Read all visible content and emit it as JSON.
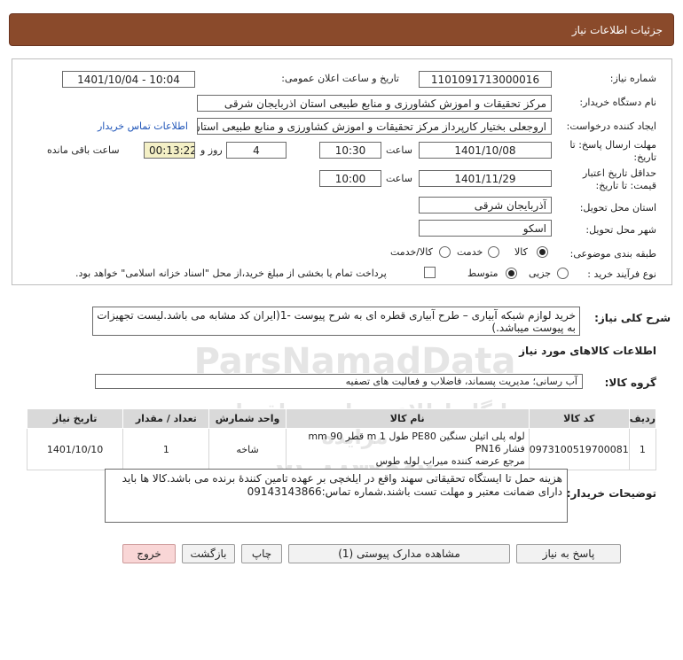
{
  "header": {
    "title": "جزئیات اطلاعات نیاز"
  },
  "form": {
    "need_number_label": "شماره نیاز:",
    "need_number": "1101091713000016",
    "announce_label": "تاریخ و ساعت اعلان عمومی:",
    "announce_value": "1401/10/04 - 10:04",
    "buyer_org_label": "نام دستگاه خریدار:",
    "buyer_org": "مرکز تحقیقات و اموزش کشاورزی و منابع طبیعی استان اذربایجان شرقی",
    "requester_label": "ایجاد کننده درخواست:",
    "requester": "اروجعلی بختیار کارپرداز مرکز تحقیقات و اموزش کشاورزی و منابع طبیعی استان ا",
    "contact_link": "اطلاعات تماس خریدار",
    "deadline_label_1": "مهلت ارسال پاسخ: تا",
    "deadline_label_2": "تاریخ:",
    "deadline_date": "1401/10/08",
    "time_label": "ساعت",
    "deadline_time": "10:30",
    "days_value": "4",
    "days_label": "روز و",
    "remaining_time": "00:13:22",
    "remaining_label": "ساعت باقی مانده",
    "validity_label_1": "حداقل تاریخ اعتبار",
    "validity_label_2": "قیمت: تا تاریخ:",
    "validity_date": "1401/11/29",
    "validity_time_label": "ساعت",
    "validity_time": "10:00",
    "province_label": "استان محل تحویل:",
    "province": "آذربایجان شرقی",
    "city_label": "شهر محل تحویل:",
    "city": "اسکو",
    "category_label": "طبقه بندی موضوعی:",
    "category_options": [
      "کالا",
      "خدمت",
      "کالا/خدمت"
    ],
    "category_selected": "کالا",
    "process_label": "نوع فرآیند خرید :",
    "process_options": [
      "جزیی",
      "متوسط"
    ],
    "process_selected": "متوسط",
    "payment_note": "پرداخت تمام یا بخشی از مبلغ خرید،از محل \"اسناد خزانه اسلامی\" خواهد بود."
  },
  "general_desc": {
    "label": "شرح کلی نیاز:",
    "text": "خرید لوازم شبکه آبیاری – طرح آبیاری قطره ای به شرح پیوست -1(ایران کد مشابه می باشد.لیست تجهیزات به پیوست میباشد.)"
  },
  "goods_section": {
    "title": "اطلاعات کالاهای مورد نیاز"
  },
  "goods_group": {
    "label": "گروه کالا:",
    "value": "آب رسانی؛ مدیریت پسماند، فاضلاب و فعالیت های تصفیه"
  },
  "table": {
    "headers": [
      "ردیف",
      "کد کالا",
      "نام کالا",
      "واحد شمارش",
      "تعداد / مقدار",
      "تاریخ نیاز"
    ],
    "rows": [
      {
        "row": "1",
        "code": "0973100519700081",
        "name_line1": "لوله پلی اتیلن سنگین PE80 طول 1 m قطر 90 mm فشار PN16",
        "name_line2": "مرجع عرضه کننده میراب لوله طوس",
        "unit": "شاخه",
        "qty": "1",
        "date": "1401/10/10"
      }
    ]
  },
  "buyer_notes": {
    "label": "توضیحات خریدار:",
    "text": "هزینه حمل تا ایستگاه تحقیقاتی سهند واقع در ایلخچی بر عهده تامین کنندۀ برنده می باشد.کالا ها باید دارای ضمانت معتبر و مهلت تست باشند.شماره تماس:09143143866"
  },
  "buttons": {
    "reply": "پاسخ به نیاز",
    "attachments": "مشاهده مدارک پیوستی (1)",
    "print": "چاپ",
    "back": "بازگشت",
    "exit": "خروج"
  },
  "watermark": {
    "brand": "ParsNamadData",
    "sub": "پایگاه اطلاع رسانی مناقصات و مزایده",
    "phone": "۰۲۱-۸۸۳۴۹۶۷۰"
  },
  "colors": {
    "header_bg": "#8a4a2b",
    "remaining_bg": "#f4f0c6",
    "exit_bg": "#f9d6d6",
    "link": "#1e54b8"
  }
}
